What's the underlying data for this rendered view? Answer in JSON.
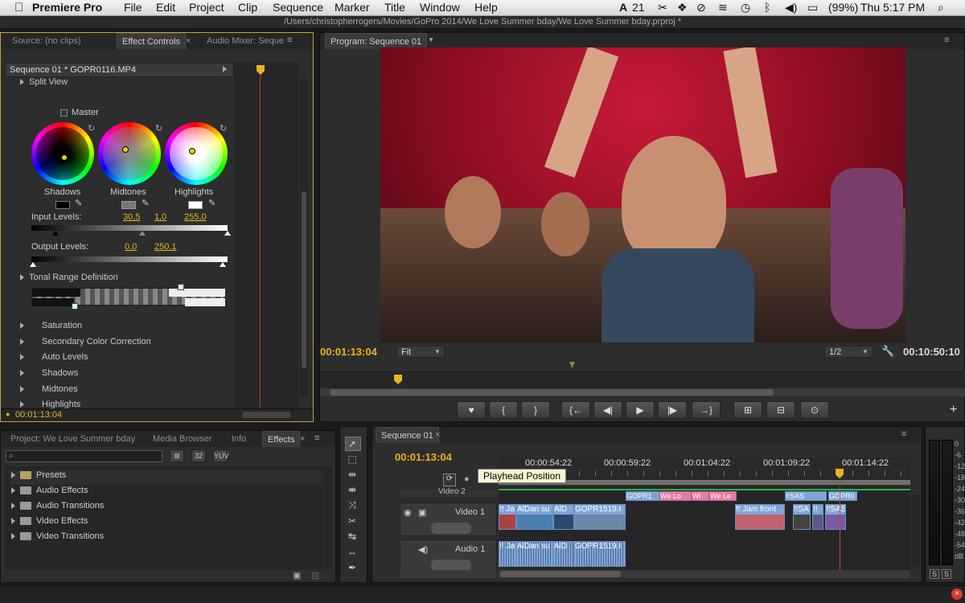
{
  "menubar": {
    "app_name": "Premiere Pro",
    "menus": [
      "File",
      "Edit",
      "Project",
      "Clip",
      "Sequence",
      "Marker",
      "Title",
      "Window",
      "Help"
    ],
    "adobe_badge": "21",
    "battery": "(99%)",
    "clock": "Thu 5:17 PM"
  },
  "window": {
    "path": "/Users/christopherrogers/Movies/GoPro 2014/We Love Summer bday/We Love Summer bday.prproj *"
  },
  "source_panel": {
    "tabs": [
      "Source: (no clips)",
      "Effect Controls",
      "Audio Mixer: Seque"
    ],
    "clip_header": "Sequence 01 * GOPR0116.MP4",
    "split_view": "Split View",
    "master": "Master",
    "wheel_labels": [
      "Shadows",
      "Midtones",
      "Highlights"
    ],
    "input_levels_label": "Input Levels:",
    "input_levels": [
      "30,5",
      "1,0",
      "255,0"
    ],
    "output_levels_label": "Output Levels:",
    "output_levels": [
      "0,0",
      "250,1"
    ],
    "tonal_range": "Tonal Range Definition",
    "effects_list": [
      "Saturation",
      "Secondary Color Correction",
      "Auto Levels",
      "Shadows",
      "Midtones",
      "Highlights"
    ],
    "timecode": "00:01:13:04"
  },
  "program_panel": {
    "tab": "Program: Sequence 01",
    "timecode_left": "00:01:13:04",
    "zoom": "Fit",
    "resolution": "1/2",
    "timecode_right": "00:10:50:10",
    "transport": [
      "♥",
      "{",
      "}",
      "{←",
      "◀|",
      "▶",
      "|▶",
      "→}",
      "⊞",
      "⊟",
      "⊙"
    ]
  },
  "project_panel": {
    "tabs": [
      "Project: We Love Summer bday",
      "Media Browser",
      "Info",
      "Effects"
    ],
    "search_placeholder": "",
    "icon_labels": [
      "32",
      "YUV"
    ],
    "items": [
      "Presets",
      "Audio Effects",
      "Audio Transitions",
      "Video Effects",
      "Video Transitions"
    ]
  },
  "timeline": {
    "tab": "Sequence 01",
    "timecode": "00:01:13:04",
    "tooltip": "Playhead Position",
    "ruler": [
      "00:00:54:22",
      "00:00:59:22",
      "00:01:04:22",
      "00:01:09:22",
      "00:01:14:22"
    ],
    "tracks": [
      "Video 2",
      "Video 1",
      "Audio 1"
    ],
    "video2_clips": [
      "GOPR1",
      "We Lo",
      "Wi",
      "We Le",
      "!!SAS",
      "GOPR0"
    ],
    "video1_clips": [
      "!! Ja",
      "AlDan su",
      "AlD",
      "GOPR1519.I",
      "!! Jam front",
      "!!SA",
      "!!",
      "!!SAS"
    ],
    "audio1_clips": [
      "!! Ja",
      "AlDan su",
      "AlD",
      "GOPR1519.I"
    ]
  },
  "meter": {
    "scale": [
      "0",
      "-6",
      "-12",
      "-18",
      "-24",
      "-30",
      "-36",
      "-42",
      "-48",
      "-54",
      "dB"
    ],
    "solo": [
      "S",
      "S"
    ]
  }
}
